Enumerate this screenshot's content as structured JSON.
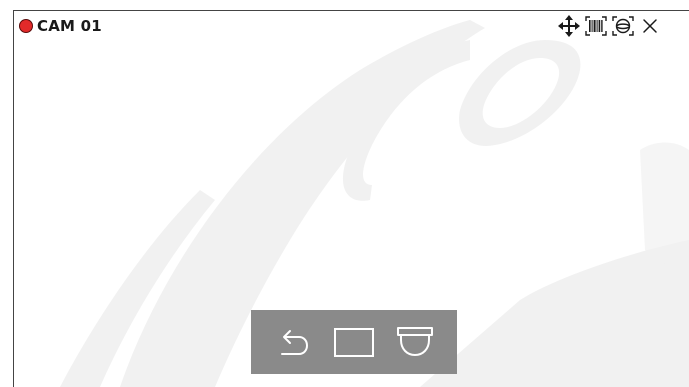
{
  "camera": {
    "name": "CAM 01",
    "recording": true,
    "rec_color": "#e22a2a"
  },
  "tile_toolbar": {
    "icons": [
      "move-icon",
      "barcode-icon",
      "fisheye-dewarp-icon",
      "close-icon"
    ]
  },
  "ptz_bar": {
    "background": "#8a8a8a",
    "icons": [
      "back-arrow-icon",
      "rectangle-view-icon",
      "dome-camera-icon"
    ]
  },
  "colors": {
    "watermark": "#f1f1f1",
    "text": "#1a1a1a",
    "icon_light": "#ffffff"
  }
}
